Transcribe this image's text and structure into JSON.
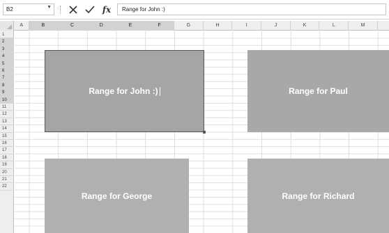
{
  "formula_bar": {
    "name_box": "B2",
    "formula": "Range for John :)",
    "cancel_icon": "x-icon",
    "enter_icon": "check-icon",
    "function_label": "fx"
  },
  "columns": [
    "A",
    "B",
    "C",
    "D",
    "E",
    "F",
    "G",
    "H",
    "I",
    "J",
    "K",
    "L",
    "M"
  ],
  "selected_columns": [
    "B",
    "C",
    "D",
    "E",
    "F"
  ],
  "rows": [
    "1",
    "2",
    "3",
    "4",
    "5",
    "6",
    "7",
    "8",
    "9",
    "10",
    "11",
    "12",
    "13",
    "14",
    "15",
    "16",
    "17",
    "18",
    "19",
    "20",
    "21",
    "22"
  ],
  "selected_rows": [
    "2",
    "3",
    "4",
    "5",
    "6",
    "7",
    "8",
    "9",
    "10"
  ],
  "ranges": {
    "john": "Range for John :)",
    "paul": "Range for Paul",
    "george": "Range for George",
    "richard": "Range for Richard"
  },
  "colors": {
    "john_fill": "#a5a5a5",
    "paul_fill": "#a8a8a8",
    "george_fill": "#b0b0b0",
    "richard_fill": "#b0b0b0"
  }
}
